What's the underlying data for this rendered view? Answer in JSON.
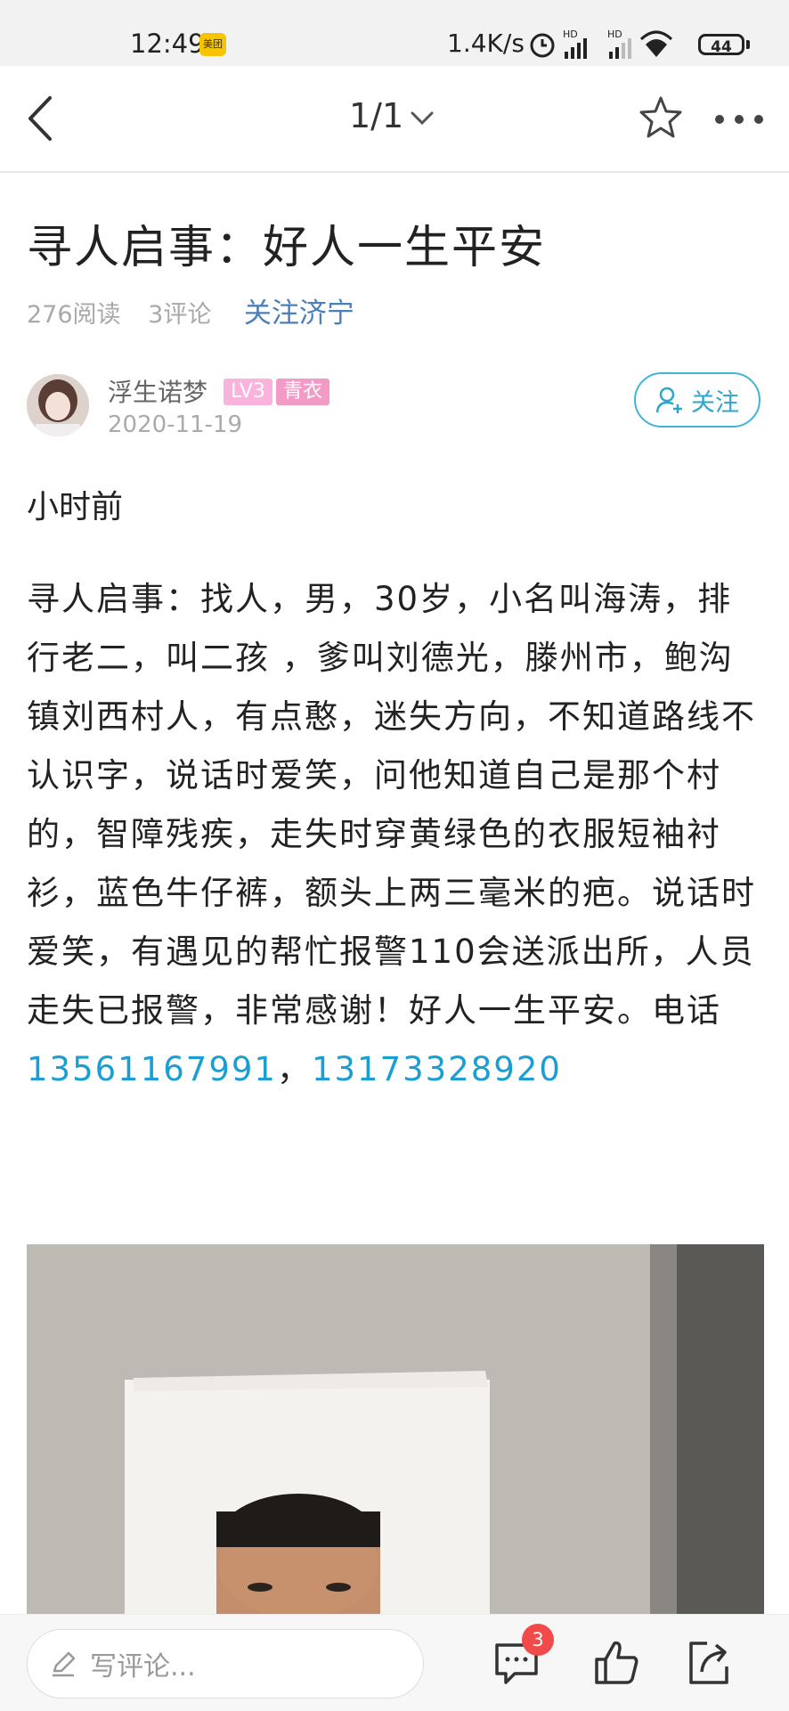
{
  "status_bar": {
    "time": "12:49",
    "app_badge": "美团",
    "net_speed": "1.4K/s",
    "battery": "44"
  },
  "header": {
    "page_indicator": "1/1"
  },
  "article": {
    "title": "寻人启事：好人一生平安",
    "read_count": "276阅读",
    "comment_count": "3评论",
    "follow_channel": "关注济宁",
    "lead": "小时前",
    "body": "寻人启事：找人，男，30岁，小名叫海涛，排行老二，叫二孩 ，爹叫刘德光，滕州市，鲍沟镇刘西村人，有点憨，迷失方向，不知道路线不认识字，说话时爱笑，问他知道自己是那个村的，智障残疾，走失时穿黄绿色的衣服短袖衬衫，蓝色牛仔裤，额头上两三毫米的疤。说话时爱笑，有遇见的帮忙报警110会送派出所，人员走失已报警，非常感谢！好人一生平安。电话",
    "phone_1": "13561167991",
    "separator": "，",
    "phone_2": "13173328920"
  },
  "author": {
    "name": "浮生诺梦",
    "level": "LV3",
    "tag": "青衣",
    "date": "2020-11-19",
    "follow_label": "关注"
  },
  "bottom_bar": {
    "comment_placeholder": "写评论...",
    "comment_badge": "3"
  },
  "colors": {
    "accent": "#2ea6c8",
    "link": "#1b9fd2",
    "channel_link": "#4b7fb8",
    "badge_red": "#f04a4a"
  }
}
